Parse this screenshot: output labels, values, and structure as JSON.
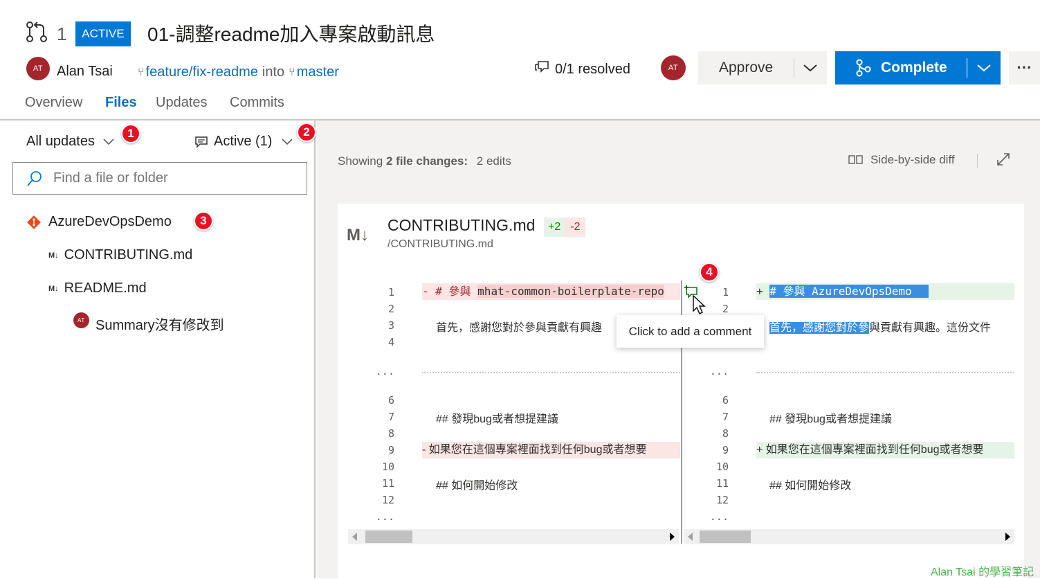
{
  "pr": {
    "number": "1",
    "status": "ACTIVE",
    "title": "01-調整readme加入專案啟動訊息",
    "author_initials": "AT",
    "author": "Alan Tsai",
    "source_branch": "feature/fix-readme",
    "into": "into",
    "target_branch": "master",
    "resolved": "0/1 resolved",
    "reviewer_initials": "AT",
    "approve_label": "Approve",
    "complete_label": "Complete",
    "more": "···"
  },
  "tabs": [
    "Overview",
    "Files",
    "Updates",
    "Commits"
  ],
  "sidebar": {
    "updates_filter": "All updates",
    "comment_filter": "Active (1)",
    "search_placeholder": "Find a file or folder",
    "repo": "AzureDevOpsDemo",
    "files": [
      "CONTRIBUTING.md",
      "README.md"
    ],
    "comment_initials": "AT",
    "comment_text": "Summary沒有修改到"
  },
  "annotations": [
    "1",
    "2",
    "3",
    "4"
  ],
  "diff_header": {
    "showing_prefix": "Showing ",
    "showing_bold": "2 file changes:",
    "showing_edits": "2 edits",
    "view_mode": "Side-by-side diff"
  },
  "file": {
    "icon_text": "M↓",
    "name": "CONTRIBUTING.md",
    "additions": "+2",
    "deletions": "-2",
    "path": "/CONTRIBUTING.md"
  },
  "diff": {
    "left": {
      "line1_prefix": "- # 參與 ",
      "line1_code": "mhat-common-boilerplate-repo",
      "line3": "首先，感謝您對於參與貢獻有興趣",
      "line7": "## 發現bug或者想提建議",
      "line9": "- 如果您在這個專案裡面找到任何bug或者想要",
      "line11": "## 如何開始修改"
    },
    "right": {
      "line1_prefix": "+ ",
      "line1_code": "# 參與 AzureDevOpsDemo",
      "line3_hl": "首先，感謝您對於參",
      "line3_rest": "與貢獻有興趣。這份文件",
      "line7": "## 發現bug或者想提建議",
      "line9": "+ 如果您在這個專案裡面找到任何bug或者想要",
      "line11": "## 如何開始修改"
    },
    "line_numbers_top": [
      "1",
      "2",
      "3",
      "4"
    ],
    "line_numbers_bottom": [
      "6",
      "7",
      "8",
      "9",
      "10",
      "11",
      "12"
    ],
    "ellipsis": "...",
    "tooltip": "Click to add a comment"
  },
  "watermark": "Alan Tsai 的學習筆記",
  "colors": {
    "brand_blue": "#0078d4",
    "avatar_red": "#a4262c",
    "annotation_red": "#e81123",
    "added_bg": "#e6f4e8",
    "deleted_bg": "#fbe5e5",
    "highlight": "#3b8ddf"
  }
}
